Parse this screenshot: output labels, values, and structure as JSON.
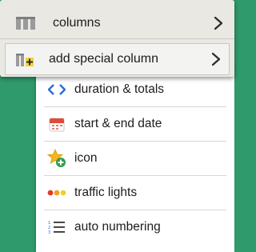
{
  "menu": {
    "items": [
      {
        "label": "columns",
        "icon": "columns-icon",
        "has_submenu": true
      },
      {
        "label": "add special column",
        "icon": "add-column-icon",
        "has_submenu": true
      }
    ]
  },
  "submenu": {
    "items": [
      {
        "label": "duration & totals",
        "icon": "code-brackets-icon"
      },
      {
        "label": "start & end date",
        "icon": "calendar-icon"
      },
      {
        "label": "icon",
        "icon": "star-plus-icon"
      },
      {
        "label": "traffic lights",
        "icon": "traffic-lights-icon"
      },
      {
        "label": "auto numbering",
        "icon": "numbered-list-icon"
      }
    ]
  },
  "colors": {
    "background": "#2f9a6b",
    "menu_bg": "#e9e8e3",
    "accent_blue": "#2a6fd6",
    "traffic_red": "#e23b2e",
    "traffic_orange": "#f0a020",
    "traffic_yellow": "#f2cf2a",
    "star_yellow": "#f5b61a",
    "plus_green": "#2f9e4a"
  }
}
